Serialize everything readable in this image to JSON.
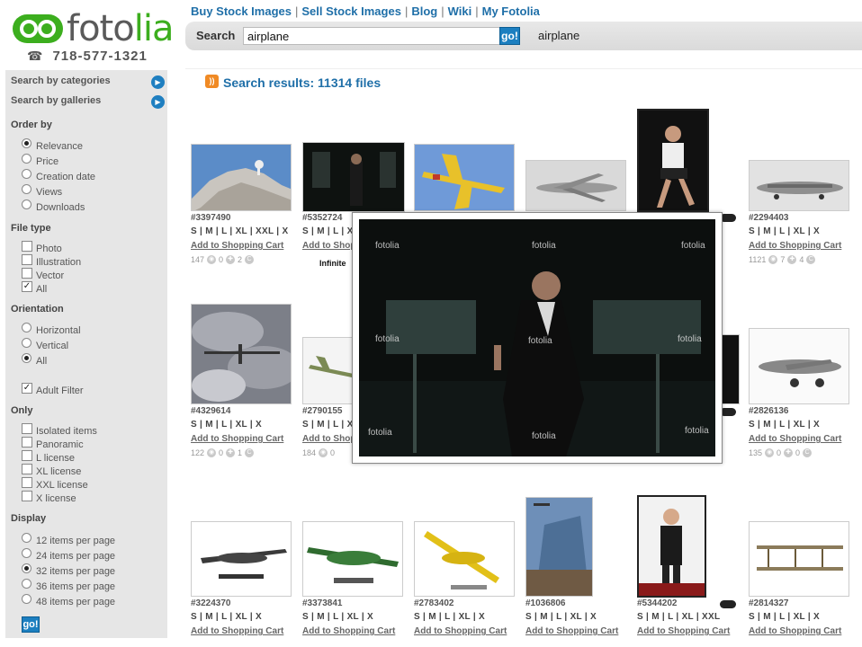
{
  "logo": {
    "part1": "foto",
    "part2": "lia"
  },
  "phone": {
    "icon": "telephone-icon",
    "number": "718-577-1321"
  },
  "topnav": [
    "Buy Stock Images",
    "Sell Stock Images",
    "Blog",
    "Wiki",
    "My Fotolia"
  ],
  "search": {
    "label": "Search",
    "value": "airplane",
    "go": "go!",
    "echo": "airplane"
  },
  "sidebar": {
    "links": [
      "Search by categories",
      "Search by galleries"
    ],
    "order_by": {
      "title": "Order by",
      "options": [
        "Relevance",
        "Price",
        "Creation date",
        "Views",
        "Downloads"
      ],
      "selected": "Relevance"
    },
    "file_type": {
      "title": "File type",
      "options": [
        "Photo",
        "Illustration",
        "Vector",
        "All"
      ],
      "checked": "All"
    },
    "orientation": {
      "title": "Orientation",
      "options": [
        "Horizontal",
        "Vertical",
        "All"
      ],
      "selected": "All"
    },
    "adult_filter": "Adult Filter",
    "only": {
      "title": "Only",
      "options": [
        "Isolated items",
        "Panoramic",
        "L license",
        "XL license",
        "XXL license",
        "X license"
      ]
    },
    "display": {
      "title": "Display",
      "options": [
        "12 items per page",
        "24 items per page",
        "32 items per page",
        "36 items per page",
        "48 items per page"
      ],
      "selected": "32 items per page"
    },
    "go": "go!"
  },
  "results": {
    "title": "Search results: 11314 files"
  },
  "cart_label": "Add to Shopping Cart",
  "infinite_label": "Infinite",
  "items": [
    {
      "id": "#3397490",
      "sizes": "S | M | L | XL | XXL | X",
      "views": "147",
      "zero": "0",
      "count": "2"
    },
    {
      "id": "#5352724",
      "sizes": "S | M | L | XL | XXL | X",
      "views": "",
      "zero": "",
      "count": ""
    },
    {
      "id": "#2294403",
      "sizes": "S | M | L | XL | X",
      "views": "1121",
      "zero": "7",
      "count": "4"
    },
    {
      "id": "#4329614",
      "sizes": "S | M | L | XL | X",
      "views": "122",
      "zero": "0",
      "count": "1"
    },
    {
      "id": "#2790155",
      "sizes": "S | M | L | XL | X",
      "views": "184",
      "zero": "0",
      "count": ""
    },
    {
      "id": "#2826136",
      "sizes": "S | M | L | XL | X",
      "views": "135",
      "zero": "0",
      "count": "0"
    },
    {
      "id": "#3224370",
      "sizes": "S | M | L | XL | X"
    },
    {
      "id": "#3373841",
      "sizes": "S | M | L | XL | X"
    },
    {
      "id": "#2783402",
      "sizes": "S | M | L | XL | X"
    },
    {
      "id": "#1036806",
      "sizes": "S | M | L | XL | X"
    },
    {
      "id": "#5344202",
      "sizes": "S | M | L | XL | XXL"
    },
    {
      "id": "#2814327",
      "sizes": "S | M | L | XL | X"
    }
  ],
  "preview": {
    "watermark": "fotolia"
  },
  "colors": {
    "brand_green": "#3cae1e",
    "link_blue": "#1f6fa8",
    "sidebar_bg": "#e6e6e6"
  }
}
